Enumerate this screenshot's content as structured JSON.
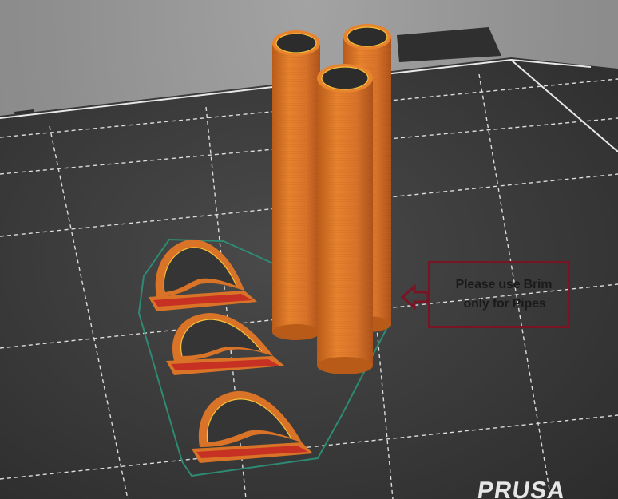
{
  "callout": {
    "line1": "Please use Brim",
    "line2": "only for Pipes",
    "border_color": "#7a1424",
    "arrow_icon": "arrow-left-icon"
  },
  "bed": {
    "brand": "PRUSA",
    "surface_color": "#353535",
    "grid_color": "#e0e0e0"
  },
  "objects": {
    "pipe_count": 3,
    "clip_count": 3,
    "filament_color": "#e07a2a",
    "brim_outline_color": "#2e8a72"
  }
}
